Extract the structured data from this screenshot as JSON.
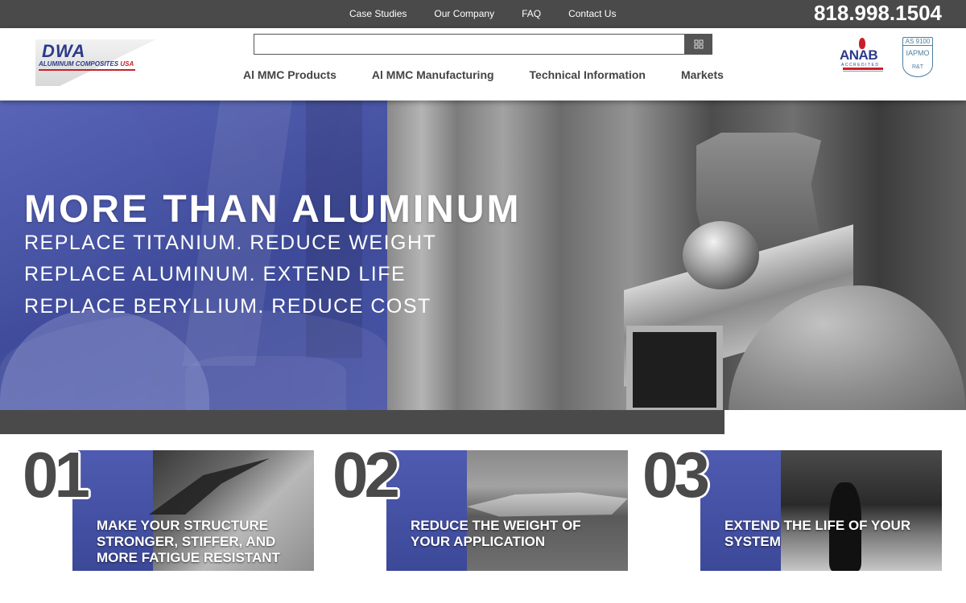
{
  "topbar": {
    "links": [
      "Case Studies",
      "Our Company",
      "FAQ",
      "Contact Us"
    ],
    "phone": "818.998.1504"
  },
  "logo": {
    "name": "DWA",
    "tagline": "ALUMINUM COMPOSITES",
    "tagline_suffix": "USA"
  },
  "search": {
    "value": "",
    "placeholder": "",
    "button_icon": "search-icon"
  },
  "nav": {
    "items": [
      "Al MMC Products",
      "Al MMC Manufacturing",
      "Technical Information",
      "Markets"
    ]
  },
  "certifications": {
    "anab": "ANAB",
    "anab_sub": "ACCREDITED",
    "iapmo_top": "AS 9100",
    "iapmo_mid": "IAPMO",
    "iapmo_bottom": "R&T"
  },
  "hero": {
    "title": "MORE THAN ALUMINUM",
    "lines": [
      "REPLACE TITANIUM. REDUCE WEIGHT",
      "REPLACE ALUMINUM. EXTEND LIFE",
      "REPLACE BERYLLIUM. REDUCE COST"
    ]
  },
  "features": [
    {
      "number": "01",
      "lines": [
        "MAKE YOUR STRUCTURE",
        "STRONGER, STIFFER, AND",
        "MORE FATIGUE RESISTANT"
      ]
    },
    {
      "number": "02",
      "lines": [
        "REDUCE THE WEIGHT OF",
        "YOUR APPLICATION"
      ]
    },
    {
      "number": "03",
      "lines": [
        "EXTEND THE LIFE OF YOUR",
        "SYSTEM"
      ]
    }
  ],
  "colors": {
    "accent_blue": "#3e4a9c",
    "dark_gray": "#4a4a4a",
    "brand_red": "#c8202a"
  }
}
